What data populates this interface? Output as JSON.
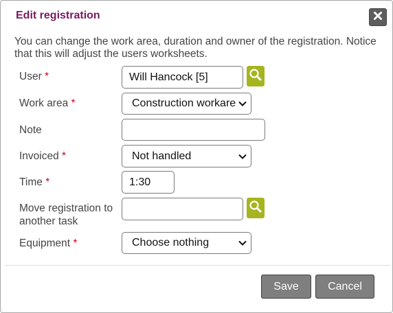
{
  "dialog": {
    "title": "Edit registration",
    "intro": "You can change the work area, duration and owner of the registration. Notice that this will adjust the users worksheets."
  },
  "required_marker": "*",
  "fields": {
    "user": {
      "label": "User",
      "value": "Will Hancock [5]",
      "required": true
    },
    "work_area": {
      "label": "Work area",
      "value": "Construction workarea",
      "required": true
    },
    "note": {
      "label": "Note",
      "value": "",
      "required": false
    },
    "invoiced": {
      "label": "Invoiced",
      "value": "Not handled",
      "required": true
    },
    "time": {
      "label": "Time",
      "value": "1:30",
      "required": true
    },
    "move_task": {
      "label": "Move registration to another task",
      "value": "",
      "required": false
    },
    "equipment": {
      "label": "Equipment",
      "value": "Choose nothing",
      "required": true
    }
  },
  "buttons": {
    "save": "Save",
    "cancel": "Cancel"
  },
  "icons": {
    "close": "close-icon",
    "lookup": "magnifier-icon",
    "dropdown": "chevron-down-icon"
  },
  "colors": {
    "title": "#7a1a5f",
    "required": "#d0021b",
    "lookup_button": "#a6b51f",
    "action_button": "#7f7f7f"
  }
}
